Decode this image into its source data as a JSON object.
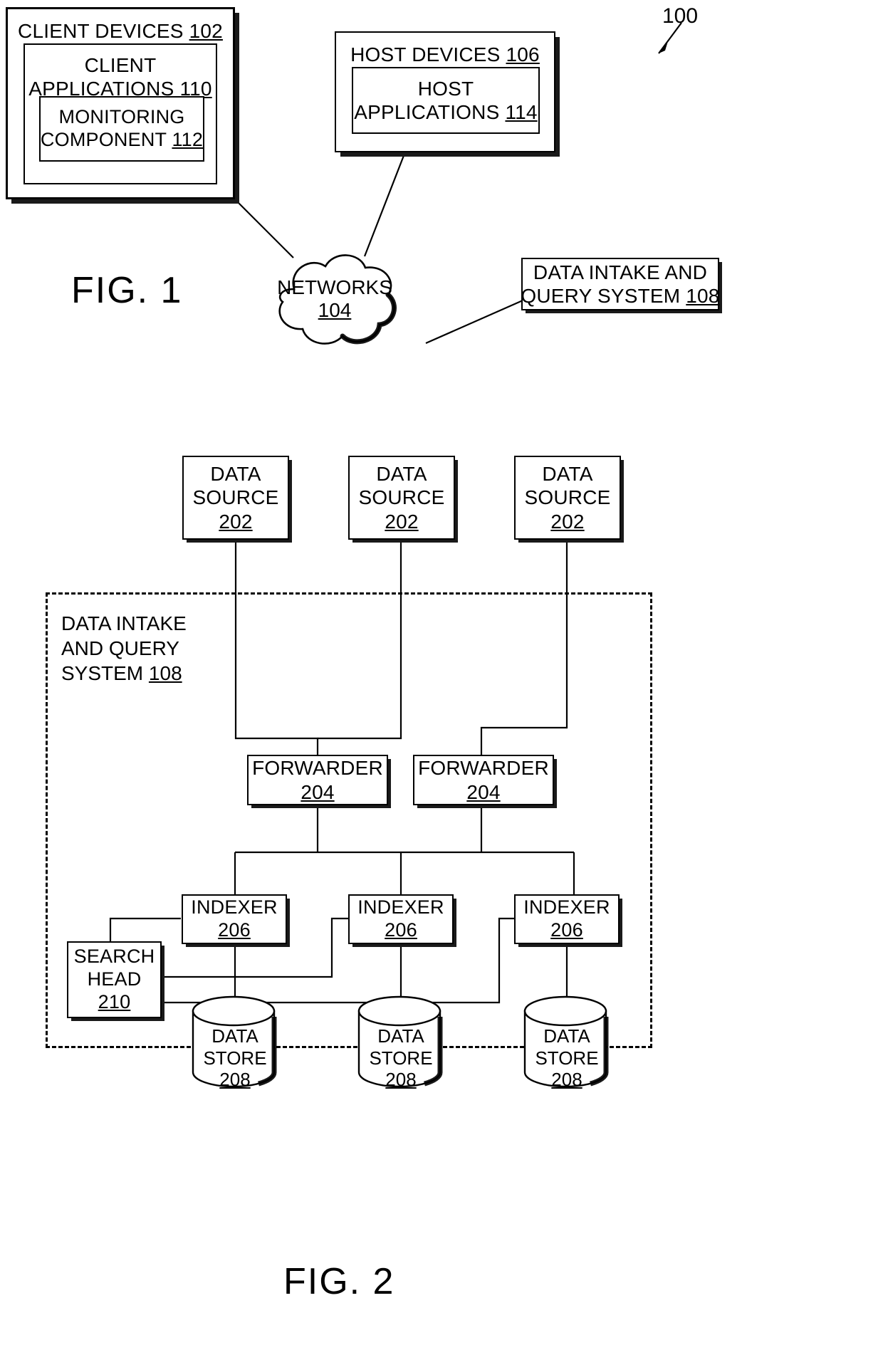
{
  "figure1": {
    "caption": "FIG. 1",
    "reference_numeral": "100",
    "client_devices": {
      "title": "CLIENT DEVICES",
      "ref": "102",
      "client_applications": {
        "line1": "CLIENT",
        "line2": "APPLICATIONS",
        "ref": "110",
        "monitoring_component": {
          "line1": "MONITORING",
          "line2": "COMPONENT",
          "ref": "112"
        }
      }
    },
    "host_devices": {
      "title": "HOST DEVICES",
      "ref": "106",
      "host_applications": {
        "line1": "HOST",
        "line2": "APPLICATIONS",
        "ref": "114"
      }
    },
    "networks": {
      "title": "NETWORKS",
      "ref": "104"
    },
    "data_intake_and_query_system": {
      "line1": "DATA INTAKE AND",
      "line2": "QUERY SYSTEM",
      "ref": "108"
    }
  },
  "figure2": {
    "caption": "FIG. 2",
    "system_boundary": {
      "line1": "DATA INTAKE",
      "line2": "AND QUERY",
      "line3": "SYSTEM",
      "ref": "108"
    },
    "data_sources": [
      {
        "line1": "DATA",
        "line2": "SOURCE",
        "ref": "202"
      },
      {
        "line1": "DATA",
        "line2": "SOURCE",
        "ref": "202"
      },
      {
        "line1": "DATA",
        "line2": "SOURCE",
        "ref": "202"
      }
    ],
    "forwarders": [
      {
        "label": "FORWARDER",
        "ref": "204"
      },
      {
        "label": "FORWARDER",
        "ref": "204"
      }
    ],
    "indexers": [
      {
        "label": "INDEXER",
        "ref": "206"
      },
      {
        "label": "INDEXER",
        "ref": "206"
      },
      {
        "label": "INDEXER",
        "ref": "206"
      }
    ],
    "data_stores": [
      {
        "line1": "DATA",
        "line2": "STORE",
        "ref": "208"
      },
      {
        "line1": "DATA",
        "line2": "STORE",
        "ref": "208"
      },
      {
        "line1": "DATA",
        "line2": "STORE",
        "ref": "208"
      }
    ],
    "search_head": {
      "line1": "SEARCH",
      "line2": "HEAD",
      "ref": "210"
    }
  },
  "colors": {
    "ink": "#000000",
    "paper": "#ffffff",
    "shadow": "#1a1a1a"
  }
}
